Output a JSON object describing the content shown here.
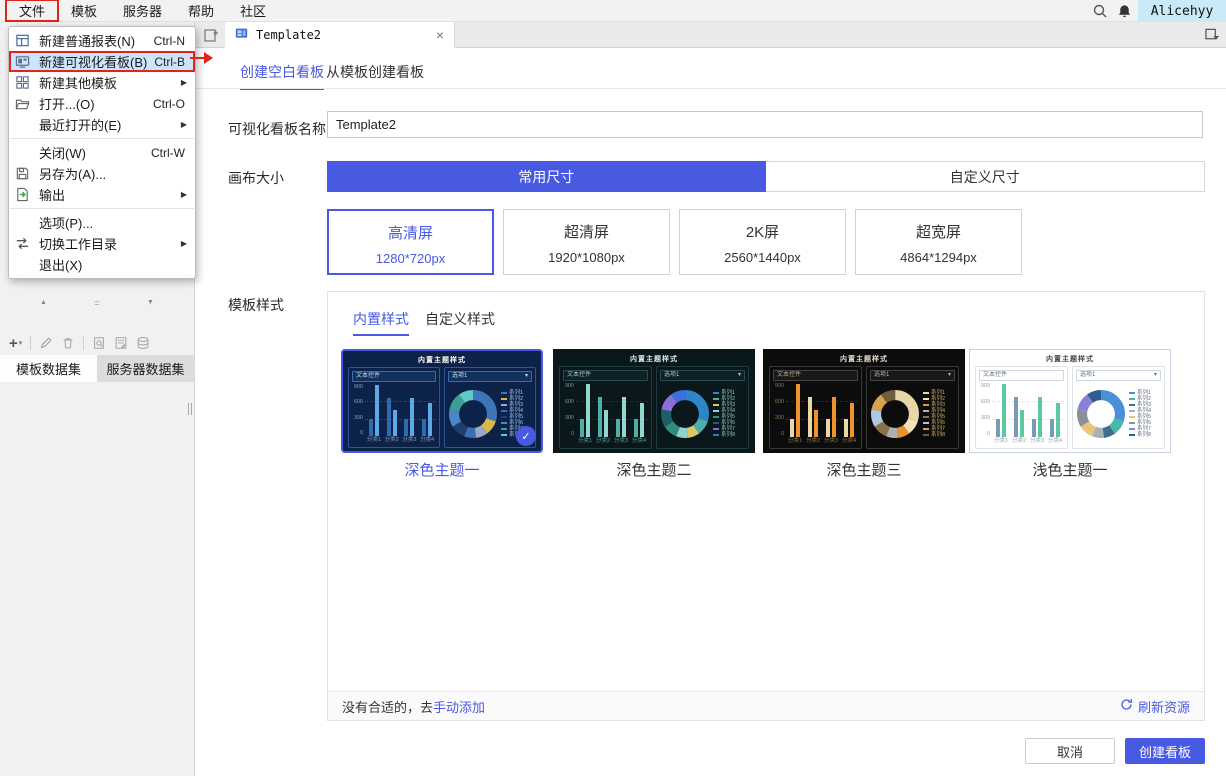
{
  "accent": "#4859E2",
  "annotation_red": "#E2231A",
  "menubar": {
    "items": [
      {
        "label": "文件",
        "annotated": true
      },
      {
        "label": "模板"
      },
      {
        "label": "服务器"
      },
      {
        "label": "帮助"
      },
      {
        "label": "社区"
      }
    ],
    "icons": [
      "search-icon",
      "notification-icon"
    ],
    "username": "Alicehyy"
  },
  "file_menu": {
    "items": [
      {
        "label": "新建普通报表(N)",
        "shortcut": "Ctrl-N",
        "icon": "new-report-icon"
      },
      {
        "label": "新建可视化看板(B)",
        "shortcut": "Ctrl-B",
        "icon": "new-dashboard-icon",
        "highlighted": true,
        "annotated": true
      },
      {
        "label": "新建其他模板",
        "icon": "new-other-template-icon",
        "submenu": true
      },
      {
        "label": "打开...(O)",
        "shortcut": "Ctrl-O",
        "icon": "open-icon"
      },
      {
        "label": "最近打开的(E)",
        "submenu": true
      },
      {
        "label": "关闭(W)",
        "shortcut": "Ctrl-W",
        "divider_above": true
      },
      {
        "label": "另存为(A)...",
        "icon": "save-as-icon"
      },
      {
        "label": "输出",
        "icon": "export-icon",
        "submenu": true
      },
      {
        "label": "选项(P)...",
        "divider_above": true
      },
      {
        "label": "切换工作目录",
        "icon": "switch-dir-icon",
        "submenu": true
      },
      {
        "label": "退出(X)"
      }
    ]
  },
  "sidebar": {
    "toolbar_groups": [
      [
        "add-icon"
      ],
      [
        "edit-icon",
        "delete-icon"
      ],
      [
        "dataset-preview-icon",
        "dataset-config-icon",
        "database-icon"
      ]
    ],
    "tabs": [
      {
        "label": "模板数据集",
        "active": true
      },
      {
        "label": "服务器数据集"
      }
    ]
  },
  "tabbar": {
    "tab_title": "Template2"
  },
  "dialog": {
    "tabs": [
      {
        "label": "创建空白看板",
        "active": true
      },
      {
        "label": "从模板创建看板"
      }
    ],
    "name_label": "可视化看板名称",
    "name_value": "Template2",
    "canvas_label": "画布大小",
    "size_modes": [
      {
        "label": "常用尺寸",
        "active": true
      },
      {
        "label": "自定义尺寸"
      }
    ],
    "sizes": [
      {
        "name": "高清屏",
        "px": "1280*720px",
        "selected": true
      },
      {
        "name": "超清屏",
        "px": "1920*1080px"
      },
      {
        "name": "2K屏",
        "px": "2560*1440px"
      },
      {
        "name": "超宽屏",
        "px": "4864*1294px"
      }
    ],
    "style_label": "模板样式",
    "style_tabs": [
      {
        "label": "内置样式",
        "active": true
      },
      {
        "label": "自定义样式"
      }
    ],
    "thumb": {
      "title": "内置主题样式",
      "text_widget": "文本控件",
      "dropdown": "选项1",
      "y_ticks": [
        "900",
        "600",
        "300",
        "0"
      ],
      "categories": [
        "分类1",
        "分类2",
        "分类3",
        "分类4"
      ],
      "bar_values": [
        [
          300,
          880
        ],
        [
          660,
          450
        ],
        [
          300,
          660
        ],
        [
          300,
          570
        ]
      ],
      "bar_max": 900,
      "legend": [
        "系列1",
        "系列2",
        "系列3",
        "系列4",
        "系列5",
        "系列6",
        "系列7",
        "系列8"
      ],
      "donut_fracs": [
        30,
        10,
        8,
        8,
        10,
        12,
        12,
        10
      ]
    },
    "themes": [
      {
        "name": "深色主题一",
        "selected": true,
        "card_bg": "#0D2248",
        "card_border": "#0D2248",
        "title_color": "#FFFFFF",
        "panel_border": "#2E5596",
        "ctrl_bg": "#12305C",
        "ctrl_border": "#3C6BB0",
        "ctrl_text": "#C8DCF0",
        "axis_text": "#7FA0C8",
        "grid": "#24456E",
        "bar_colors": [
          "#2E6AAE",
          "#5FA8E8"
        ],
        "donut": [
          "#3E74B8",
          "#D9B845",
          "#98A8C8",
          "#3E6EB0",
          "#1E3E6E",
          "#4A86C8",
          "#3E9E96",
          "#5FC8C8"
        ],
        "legend_text": "#9FC0E8"
      },
      {
        "name": "深色主题二",
        "card_bg": "#0A171B",
        "card_border": "#0A171B",
        "title_color": "#DFEDEC",
        "panel_border": "#1E3A40",
        "ctrl_bg": "#0E2126",
        "ctrl_border": "#2A4A52",
        "ctrl_text": "#A8C8C8",
        "axis_text": "#6E9898",
        "grid": "#1A3238",
        "bar_colors": [
          "#4FAEA6",
          "#93D8D0"
        ],
        "donut": [
          "#2E86C8",
          "#4FAEA6",
          "#D9C96B",
          "#8FD4CC",
          "#2E8E7E",
          "#1E5E66",
          "#8A6FD9",
          "#3E6EDC"
        ],
        "legend_text": "#8FC0C0"
      },
      {
        "name": "深色主题三",
        "card_bg": "#0C0C0C",
        "card_border": "#0C0C0C",
        "title_color": "#E8E0D0",
        "panel_border": "#383838",
        "ctrl_bg": "#181818",
        "ctrl_border": "#454545",
        "ctrl_text": "#C0B090",
        "axis_text": "#8A7A58",
        "grid": "#2A2A2A",
        "bar_colors": [
          "#EAD9A8",
          "#F0922D"
        ],
        "donut": [
          "#E8D5A8",
          "#F5E2B8",
          "#E8922D",
          "#B0B0B0",
          "#8A7348",
          "#AEC8E4",
          "#D9A050",
          "#6E5E3E"
        ],
        "legend_text": "#C8A868"
      },
      {
        "name": "浅色主题一",
        "card_bg": "#FFFFFF",
        "card_border": "#C8D2DE",
        "title_color": "#444444",
        "panel_border": "#DEE3EA",
        "ctrl_bg": "#FFFFFF",
        "ctrl_border": "#D0D6DE",
        "ctrl_text": "#667080",
        "axis_text": "#99A2AC",
        "grid": "#E4E8EC",
        "bar_colors": [
          "#7A9BB5",
          "#5BC8A0"
        ],
        "donut": [
          "#4A90D9",
          "#4AB8A8",
          "#3E6E8E",
          "#A8B0B8",
          "#E8C878",
          "#8A8F98",
          "#8A7FD9",
          "#2E5E8E"
        ],
        "legend_text": "#667080"
      }
    ],
    "footer_hint_prefix": "没有合适的，去",
    "footer_hint_link": "手动添加",
    "refresh_label": "刷新资源",
    "cancel_label": "取消",
    "create_label": "创建看板"
  }
}
